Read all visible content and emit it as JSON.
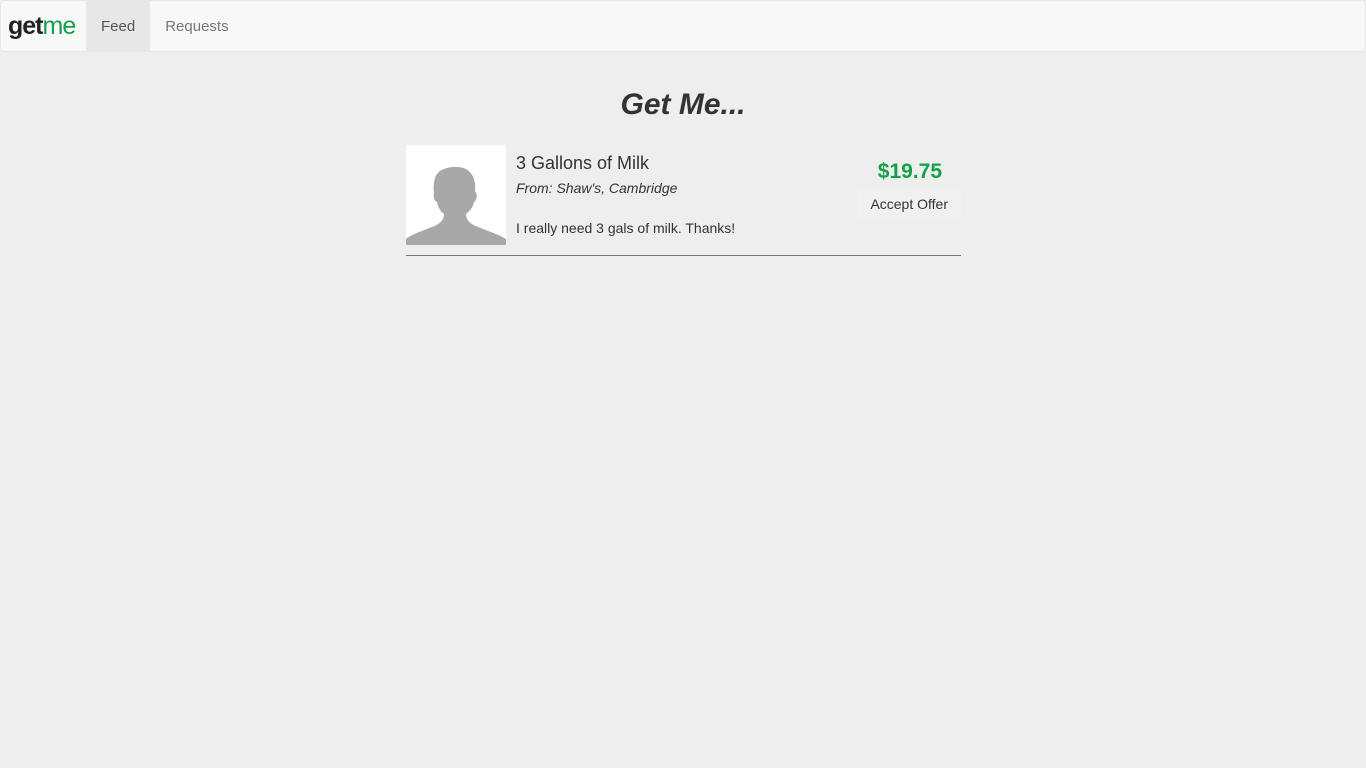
{
  "nav": {
    "brand_get": "get",
    "brand_me": "me",
    "items": [
      {
        "label": "Feed",
        "active": true
      },
      {
        "label": "Requests",
        "active": false
      }
    ]
  },
  "main": {
    "title": "Get Me..."
  },
  "requests": [
    {
      "title": "3 Gallons of Milk",
      "from": "From: Shaw's, Cambridge",
      "description": "I really need 3 gals of milk. Thanks!",
      "price": "$19.75",
      "action_label": "Accept Offer"
    }
  ],
  "colors": {
    "brand_green": "#12a14a",
    "background": "#eeeeee",
    "navbar": "#f8f8f8"
  }
}
